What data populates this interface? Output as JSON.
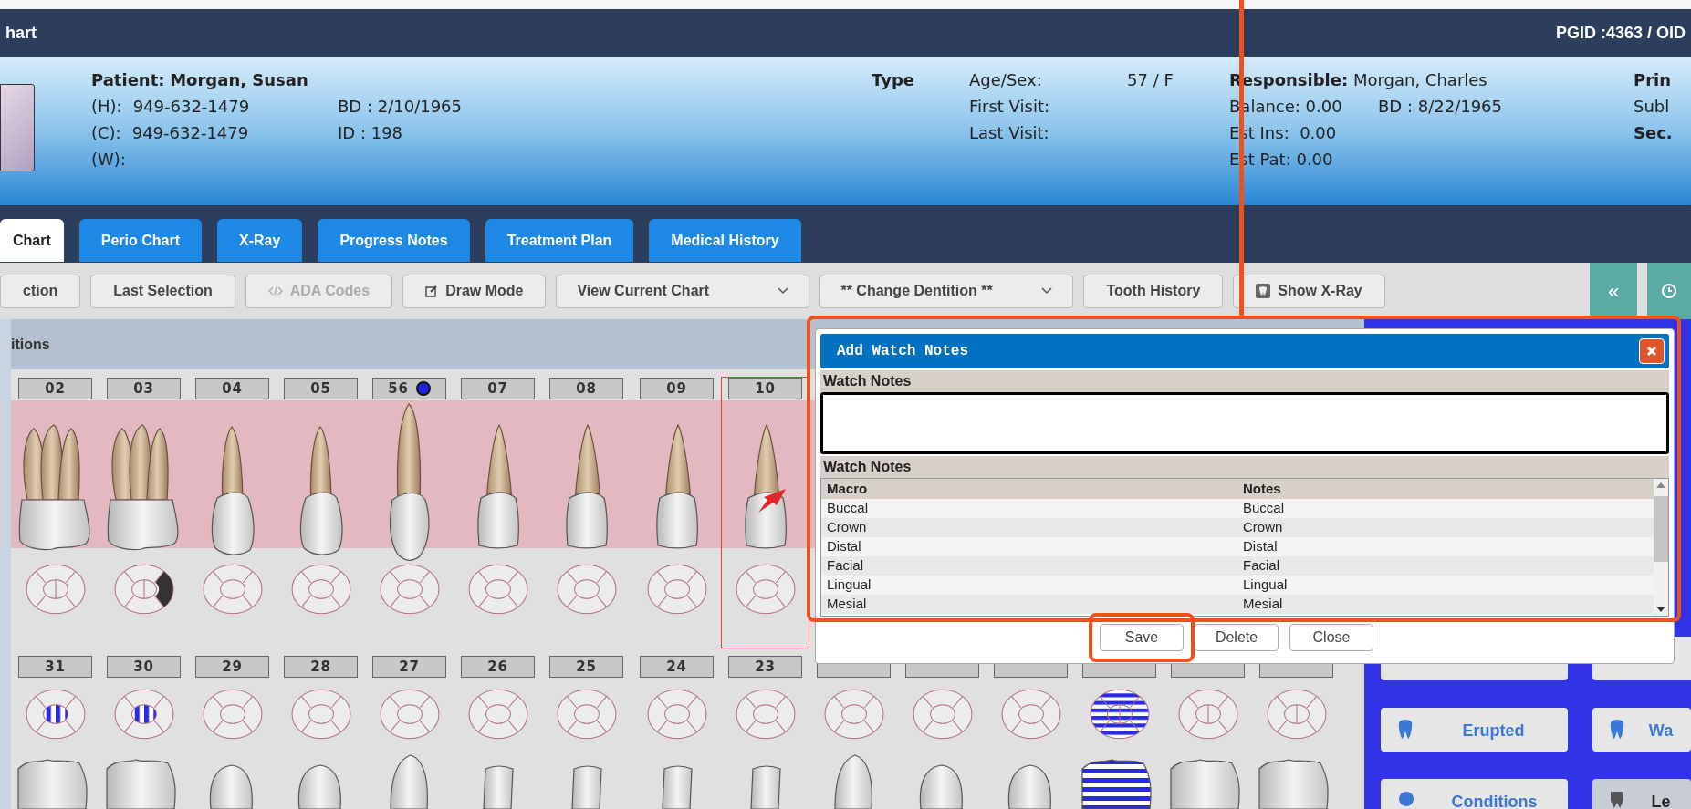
{
  "window": {
    "title": "hart",
    "ids": "PGID :4363 / OID"
  },
  "patient": {
    "label": "Patient:",
    "name": "Morgan, Susan",
    "phones": [
      {
        "label": "(H):",
        "value": "949-632-1479"
      },
      {
        "label": "(C):",
        "value": "949-632-1479"
      },
      {
        "label": "(W):"
      }
    ],
    "bd": "BD : 2/10/1965",
    "id": "ID : 198"
  },
  "type_label": "Type",
  "visit": [
    {
      "label": "Age/Sex:",
      "value": "57 / F"
    },
    {
      "label": "First Visit:"
    },
    {
      "label": "Last Visit:"
    }
  ],
  "responsible": {
    "label": "Responsible:",
    "name": "Morgan, Charles",
    "lines": [
      "Balance: 0.00",
      "Est Ins:  0.00",
      "Est Pat: 0.00"
    ],
    "bd": "BD : 8/22/1965"
  },
  "insurance": [
    {
      "text": "Prin",
      "bold": true
    },
    {
      "text": "Subl",
      "bold": false
    },
    {
      "text": "Sec.",
      "bold": true
    }
  ],
  "tabs": [
    {
      "label": "Chart",
      "selected": true
    },
    {
      "label": "Perio Chart",
      "selected": false
    },
    {
      "label": "X-Ray",
      "selected": false
    },
    {
      "label": "Progress Notes",
      "selected": false
    },
    {
      "label": "Treatment Plan",
      "selected": false
    },
    {
      "label": "Medical History",
      "selected": false
    }
  ],
  "toolbar": [
    {
      "label": "ction",
      "kind": "button",
      "disabled": false
    },
    {
      "label": "Last Selection",
      "kind": "button",
      "disabled": false
    },
    {
      "label": "ADA Codes",
      "kind": "code",
      "disabled": true
    },
    {
      "label": "Draw Mode",
      "kind": "edit",
      "disabled": false
    },
    {
      "label": "View Current Chart",
      "kind": "dropdown",
      "disabled": false
    },
    {
      "label": "** Change Dentition **",
      "kind": "dropdown",
      "disabled": false
    },
    {
      "label": "Tooth History",
      "kind": "button",
      "disabled": false
    },
    {
      "label": "Show X-Ray",
      "kind": "xray",
      "disabled": false
    }
  ],
  "toolbar_right": [
    "«"
  ],
  "section_label": "itions",
  "upper_teeth": [
    {
      "number": "02",
      "kind": "molar",
      "dark": false,
      "striped": false,
      "full_stripes": false,
      "split": true,
      "dot": false,
      "selected": false
    },
    {
      "number": "03",
      "kind": "molar",
      "dark": true,
      "striped": false,
      "full_stripes": false,
      "split": true,
      "dot": false,
      "selected": false
    },
    {
      "number": "04",
      "kind": "premolar",
      "dark": false,
      "striped": false,
      "full_stripes": false,
      "split": false,
      "dot": false,
      "selected": false
    },
    {
      "number": "05",
      "kind": "premolar",
      "dark": false,
      "striped": false,
      "full_stripes": false,
      "split": false,
      "dot": false,
      "selected": false
    },
    {
      "number": "56",
      "kind": "canine",
      "dark": false,
      "striped": false,
      "full_stripes": false,
      "split": false,
      "dot": true,
      "selected": false
    },
    {
      "number": "07",
      "kind": "incisor",
      "dark": false,
      "striped": false,
      "full_stripes": false,
      "split": false,
      "dot": false,
      "selected": false
    },
    {
      "number": "08",
      "kind": "incisor",
      "dark": false,
      "striped": false,
      "full_stripes": false,
      "split": false,
      "dot": false,
      "selected": false
    },
    {
      "number": "09",
      "kind": "incisor",
      "dark": false,
      "striped": false,
      "full_stripes": false,
      "split": false,
      "dot": false,
      "selected": false
    },
    {
      "number": "10",
      "kind": "incisor",
      "dark": false,
      "striped": false,
      "full_stripes": false,
      "split": false,
      "dot": false,
      "selected": true
    }
  ],
  "lower_teeth": [
    {
      "number": "31",
      "kind": "molar",
      "dark": false,
      "striped": true,
      "full_stripes": false,
      "split": false
    },
    {
      "number": "30",
      "kind": "molar",
      "dark": false,
      "striped": true,
      "full_stripes": false,
      "split": false
    },
    {
      "number": "29",
      "kind": "premolar",
      "dark": false,
      "striped": false,
      "full_stripes": false,
      "split": false
    },
    {
      "number": "28",
      "kind": "premolar",
      "dark": false,
      "striped": false,
      "full_stripes": false,
      "split": false
    },
    {
      "number": "27",
      "kind": "canine",
      "dark": false,
      "striped": false,
      "full_stripes": false,
      "split": false
    },
    {
      "number": "26",
      "kind": "incisor",
      "dark": false,
      "striped": false,
      "full_stripes": false,
      "split": false
    },
    {
      "number": "25",
      "kind": "incisor",
      "dark": false,
      "striped": false,
      "full_stripes": false,
      "split": false
    },
    {
      "number": "24",
      "kind": "incisor",
      "dark": false,
      "striped": false,
      "full_stripes": false,
      "split": false
    },
    {
      "number": "23",
      "kind": "incisor",
      "dark": false,
      "striped": false,
      "full_stripes": false,
      "split": false
    },
    {
      "kind": "canine",
      "dark": false,
      "striped": false,
      "full_stripes": false,
      "split": false
    },
    {
      "kind": "premolar",
      "dark": false,
      "striped": false,
      "full_stripes": false,
      "split": false
    },
    {
      "kind": "premolar",
      "dark": false,
      "striped": false,
      "full_stripes": false,
      "split": false
    },
    {
      "kind": "molar",
      "dark": false,
      "striped": false,
      "full_stripes": true,
      "split": true
    },
    {
      "kind": "molar",
      "dark": false,
      "striped": false,
      "full_stripes": false,
      "split": true
    },
    {
      "kind": "molar",
      "dark": false,
      "striped": false,
      "full_stripes": false,
      "split": true
    }
  ],
  "dialog": {
    "title": "Add Watch Notes",
    "input_label": "Watch Notes",
    "list_label": "Watch Notes",
    "columns": [
      "Macro",
      "Notes"
    ],
    "rows": [
      [
        "Buccal",
        "Buccal"
      ],
      [
        "Crown",
        "Crown"
      ],
      [
        "Distal",
        "Distal"
      ],
      [
        "Facial",
        "Facial"
      ],
      [
        "Lingual",
        "Lingual"
      ],
      [
        "Mesial",
        "Mesial"
      ]
    ],
    "buttons": [
      {
        "label": "Save",
        "highlighted": true
      },
      {
        "label": "Delete",
        "highlighted": false
      },
      {
        "label": "Close",
        "highlighted": false
      }
    ]
  },
  "side_buttons": [
    {
      "label": "Erupted",
      "kind": "tooth"
    },
    {
      "label": "Wa",
      "kind": "tooth2"
    },
    {
      "label": "Conditions",
      "kind": "cond"
    },
    {
      "label": "Le",
      "kind": "legend"
    }
  ]
}
